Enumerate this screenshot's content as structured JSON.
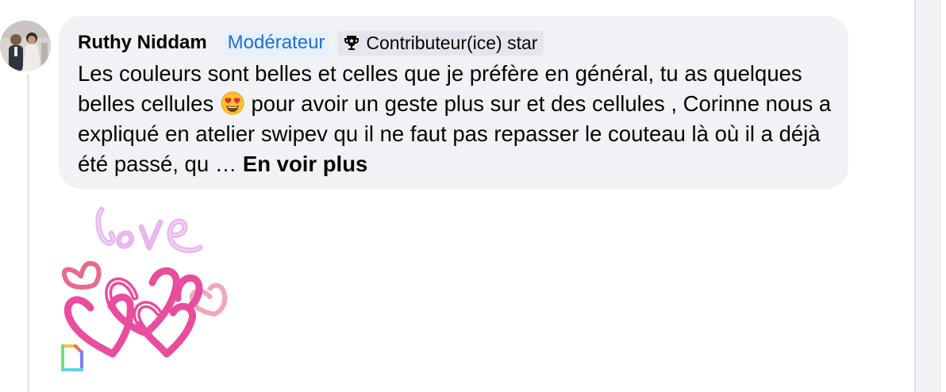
{
  "comment": {
    "author": "Ruthy Niddam",
    "badges": {
      "moderator": "Modérateur",
      "contributor": "Contributeur(ice) star"
    },
    "text_part1": "Les couleurs sont belles et celles que je préfère en général, tu as quelques belles cellules ",
    "emoji": "heart-eyes-emoji",
    "text_part2": " pour avoir un geste plus sur et des cellules , Corinne nous a expliqué en atelier swipev qu il ne faut pas repasser le couteau là où il a déjà été passé, qu … ",
    "see_more": "En voir plus",
    "sticker": {
      "name": "love-hearts-sticker",
      "word": "love"
    }
  },
  "icons": {
    "trophy": "trophy-icon",
    "gif": "gif-file-icon"
  },
  "colors": {
    "bubble": "#f0f2f5",
    "moderator_text": "#1b6fd8",
    "moderator_bg": "#e7f0fd",
    "star_badge_bg": "#e4e6eb",
    "heart_pink": "#e84d9e",
    "heart_light": "#f2a7b8",
    "love_text": "#e9b6ef"
  }
}
